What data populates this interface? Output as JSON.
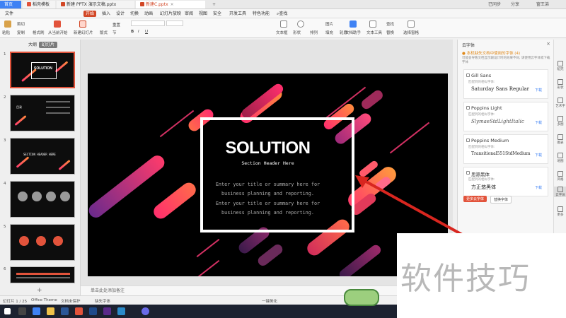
{
  "titlebar": {
    "tabs": [
      {
        "label": "首页"
      },
      {
        "label": "稻壳模板"
      },
      {
        "label": "新建 PPTX 演示文稿.pptx"
      },
      {
        "label": "新建C.pptx"
      }
    ],
    "plus": "+",
    "sync_label": "已同步",
    "share_label": "分享",
    "user_label": "窗王弟"
  },
  "menubar": {
    "file": "文件",
    "items": [
      "开始",
      "插入",
      "设计",
      "切换",
      "动画",
      "幻灯片放映",
      "审阅",
      "视图",
      "安全",
      "开发工具",
      "特色功能"
    ],
    "search": "查找"
  },
  "ribbon": {
    "paste": "粘贴",
    "cut": "剪切",
    "copy": "复制",
    "format_painter": "格式刷",
    "from_current": "从当前开始",
    "new_slide": "新建幻灯片",
    "layout": "版式",
    "section": "节",
    "reset": "重置",
    "textbox": "文本框",
    "shape": "形状",
    "arrange": "排列",
    "picture": "图片",
    "fill": "填充",
    "outline": "轮廓",
    "doc_assistant": "文档助手",
    "text_tools": "文本工具",
    "find": "查找",
    "replace": "替换",
    "select_pane": "选择窗格"
  },
  "leftpanel": {
    "tab_outline": "大纲",
    "tab_slides": "幻灯片",
    "thumbs": [
      {
        "num": "1",
        "title": "SOLUTION"
      },
      {
        "num": "2",
        "title": "目录"
      },
      {
        "num": "3",
        "title": "SECTION HEADER HERE"
      },
      {
        "num": "4",
        "title": ""
      },
      {
        "num": "5",
        "title": ""
      },
      {
        "num": "6",
        "title": ""
      }
    ],
    "add": "+"
  },
  "slide": {
    "title": "SOLUTION",
    "subtitle": "Section Header Here",
    "body": [
      "Enter your title or summary here for",
      "business planning and reporting.",
      "Enter your title or summary here for",
      "business planning and reporting."
    ],
    "colors": {
      "accent1": "#ff2f6d",
      "accent2": "#ff8a3d",
      "frame": "#ffffff"
    }
  },
  "notes": {
    "placeholder": "单击此处添加备注"
  },
  "fontpanel": {
    "header": "云字体",
    "warning": "本机缺失文档中使用的字体 (4)",
    "desc": "可能会导致文档显示跟设计时的效果不同, 请使用云字体或下载字体",
    "items": [
      {
        "name": "Gill Sans",
        "note": "匹配到的相似字体:",
        "match": "Saturday Sans Regular",
        "action": "下载"
      },
      {
        "name": "Poppins Light",
        "note": "匹配到的相似字体:",
        "match": "SlymaeStdLightItalic",
        "action": "下载"
      },
      {
        "name": "Poppins Medium",
        "note": "匹配到的相似字体:",
        "match": "Transitional551StdMedium",
        "action": "下载"
      },
      {
        "name": "思源黑体",
        "note": "匹配到的相似字体:",
        "match": "方正悠黑体",
        "action": "下载"
      }
    ],
    "btn_cloud": "更多云字体",
    "btn_replace": "替换字体"
  },
  "righttools": [
    "稻壳",
    "形状",
    "艺术字",
    "多图",
    "图表",
    "地图",
    "风格",
    "云字体",
    "更多"
  ],
  "statusbar": {
    "slide_counter": "幻灯片 1 / 25",
    "theme": "Office Theme",
    "doc_protect": "文档未保护",
    "missing_font": "缺失字体",
    "beautify": "一键美化"
  },
  "watermark": "软件技巧"
}
